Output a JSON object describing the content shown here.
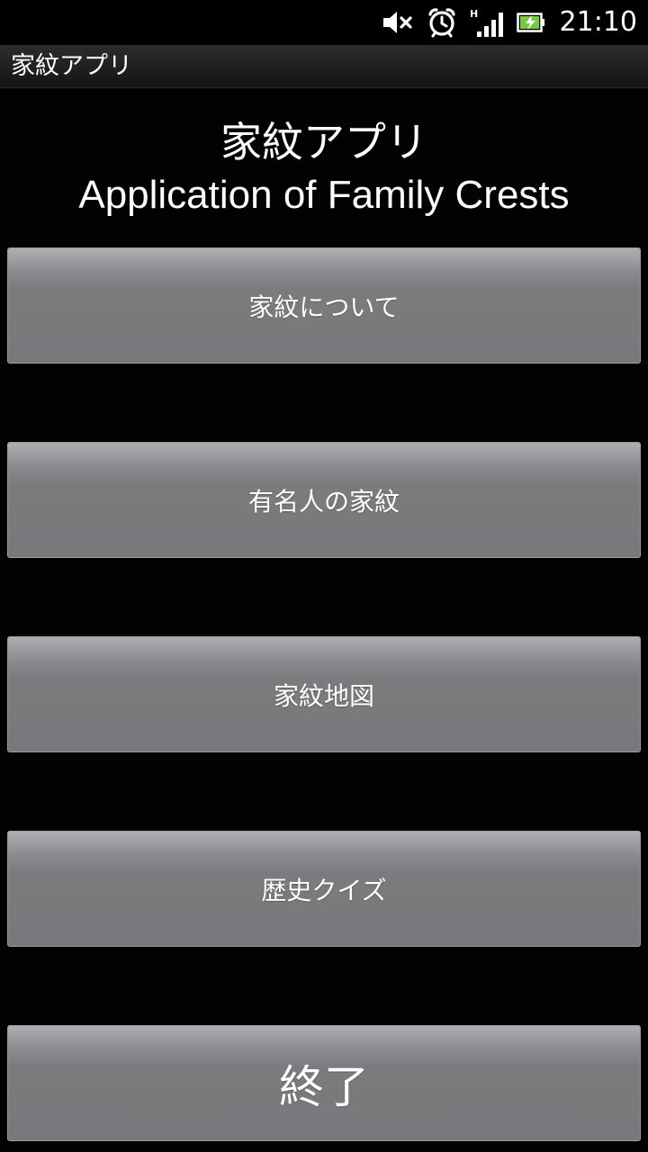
{
  "status_bar": {
    "time": "21:10",
    "icons": [
      "volume-muted-icon",
      "alarm-clock-icon",
      "signal-strength-icon",
      "battery-charging-icon"
    ],
    "signal_label": "H"
  },
  "title_bar": {
    "title": "家紋アプリ"
  },
  "heading": {
    "title_jp": "家紋アプリ",
    "title_en": "Application of Family Crests"
  },
  "menu": {
    "about": "家紋について",
    "famous": "有名人の家紋",
    "map": "家紋地図",
    "quiz": "歴史クイズ",
    "exit": "終了"
  },
  "colors": {
    "background": "#020203",
    "button": "#7a787b",
    "text": "#ffffff"
  }
}
